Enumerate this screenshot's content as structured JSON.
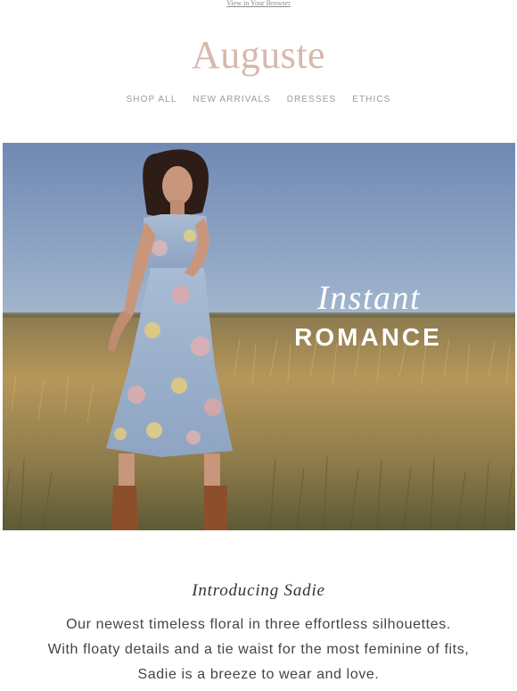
{
  "header": {
    "browser_link": "View in Your Browser",
    "logo": "Auguste",
    "nav": [
      "SHOP ALL",
      "NEW ARRIVALS",
      "DRESSES",
      "ETHICS"
    ]
  },
  "hero": {
    "script_text": "Instant",
    "caps_text": "ROMANCE"
  },
  "intro": {
    "title": "Introducing Sadie",
    "lines": [
      "Our newest timeless floral in three effortless silhouettes.",
      "With floaty details and a tie waist for the most feminine of fits,",
      "Sadie is a breeze to wear and love."
    ]
  },
  "colors": {
    "logo": "#d7b8ad",
    "sky_top": "#6f89b3",
    "sky_bottom": "#a4b7cf",
    "field": "#a58a52",
    "dress": "#9db2cc"
  }
}
